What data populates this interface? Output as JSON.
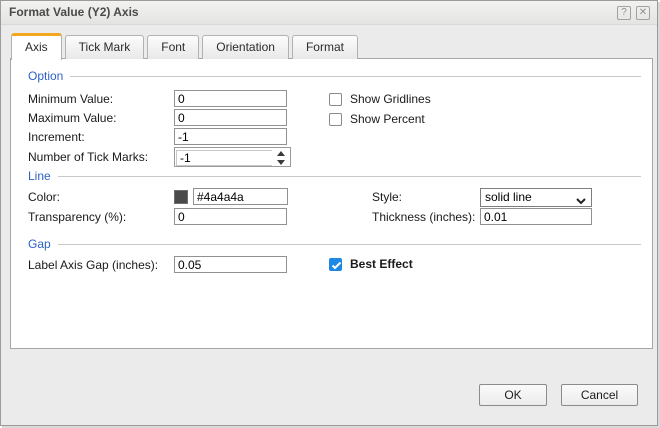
{
  "titlebar": {
    "title": "Format Value (Y2) Axis",
    "help_glyph": "?",
    "close_glyph": "✕"
  },
  "tabs": [
    {
      "label": "Axis",
      "active": true
    },
    {
      "label": "Tick Mark",
      "active": false
    },
    {
      "label": "Font",
      "active": false
    },
    {
      "label": "Orientation",
      "active": false
    },
    {
      "label": "Format",
      "active": false
    }
  ],
  "option": {
    "title": "Option",
    "rows": [
      {
        "label": "Minimum Value:",
        "value": "0"
      },
      {
        "label": "Maximum Value:",
        "value": "0"
      },
      {
        "label": "Increment:",
        "value": "-1"
      },
      {
        "label": "Number of Tick Marks:",
        "value": "-1"
      }
    ],
    "checkboxes": [
      {
        "label": "Show Gridlines",
        "checked": false
      },
      {
        "label": "Show Percent",
        "checked": false
      }
    ]
  },
  "line": {
    "title": "Line",
    "color_label": "Color:",
    "color_value": "#4a4a4a",
    "style_label": "Style:",
    "style_value": "solid line",
    "transparency_label": "Transparency (%):",
    "transparency_value": "0",
    "thickness_label": "Thickness (inches):",
    "thickness_value": "0.01"
  },
  "gap": {
    "title": "Gap",
    "label": "Label Axis Gap (inches):",
    "value": "0.05",
    "checkbox": {
      "label": "Best Effect",
      "checked": true
    }
  },
  "footer": {
    "ok": "OK",
    "cancel": "Cancel"
  },
  "colors": {
    "accent_orange": "#f2a71e",
    "section_blue": "#2f62c8",
    "checkbox_blue": "#1e88e5",
    "line_swatch": "#4a4a4a"
  }
}
